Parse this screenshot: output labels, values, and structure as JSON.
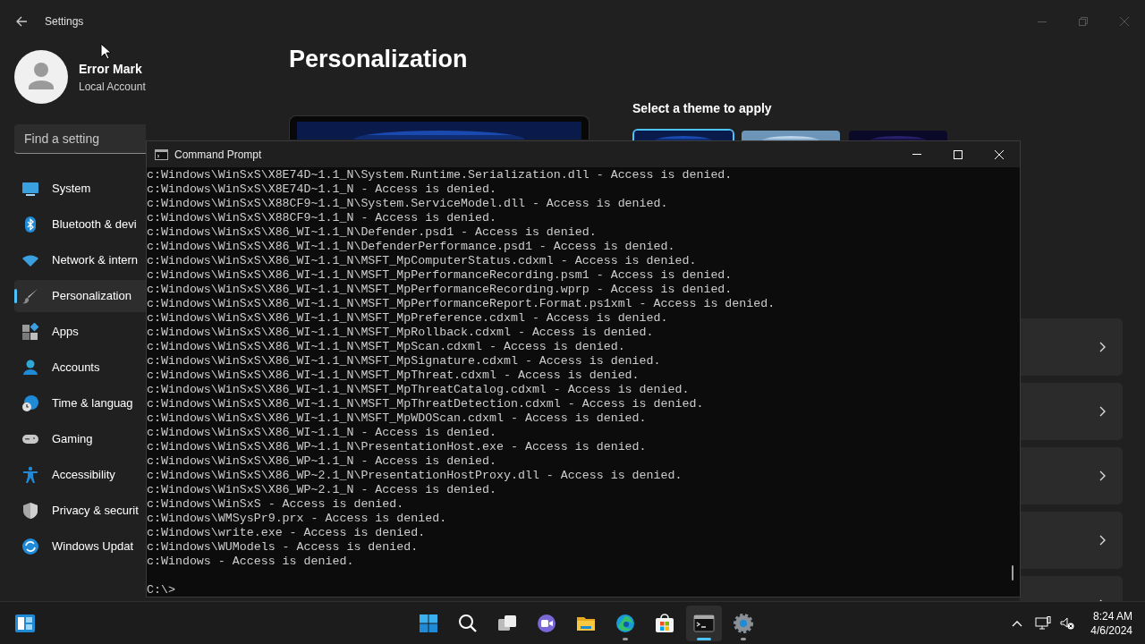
{
  "settings": {
    "title": "Settings",
    "user": {
      "name": "Error Mark",
      "account": "Local Account"
    },
    "search": {
      "placeholder": "Find a setting"
    },
    "nav": [
      {
        "kind": "system",
        "label": "System",
        "selected": false
      },
      {
        "kind": "bluetooth",
        "label": "Bluetooth & devi",
        "selected": false
      },
      {
        "kind": "network",
        "label": "Network & intern",
        "selected": false
      },
      {
        "kind": "personalization",
        "label": "Personalization",
        "selected": true
      },
      {
        "kind": "apps",
        "label": "Apps",
        "selected": false
      },
      {
        "kind": "accounts",
        "label": "Accounts",
        "selected": false
      },
      {
        "kind": "time",
        "label": "Time & languag",
        "selected": false
      },
      {
        "kind": "gaming",
        "label": "Gaming",
        "selected": false
      },
      {
        "kind": "accessibility",
        "label": "Accessibility",
        "selected": false
      },
      {
        "kind": "privacy",
        "label": "Privacy & securit",
        "selected": false
      },
      {
        "kind": "update",
        "label": "Windows Updat",
        "selected": false
      }
    ],
    "page_title": "Personalization",
    "theme_heading": "Select a theme to apply",
    "themes": [
      {
        "kind": "picture",
        "selected": true
      },
      {
        "kind": "picture",
        "selected": false
      },
      {
        "kind": "picture",
        "selected": false
      }
    ]
  },
  "cmd": {
    "title": "Command Prompt",
    "lines": [
      "c:Windows\\WinSxS\\X8E74D~1.1_N\\System.Runtime.Serialization.dll - Access is denied.",
      "c:Windows\\WinSxS\\X8E74D~1.1_N - Access is denied.",
      "c:Windows\\WinSxS\\X88CF9~1.1_N\\System.ServiceModel.dll - Access is denied.",
      "c:Windows\\WinSxS\\X88CF9~1.1_N - Access is denied.",
      "c:Windows\\WinSxS\\X86_WI~1.1_N\\Defender.psd1 - Access is denied.",
      "c:Windows\\WinSxS\\X86_WI~1.1_N\\DefenderPerformance.psd1 - Access is denied.",
      "c:Windows\\WinSxS\\X86_WI~1.1_N\\MSFT_MpComputerStatus.cdxml - Access is denied.",
      "c:Windows\\WinSxS\\X86_WI~1.1_N\\MSFT_MpPerformanceRecording.psm1 - Access is denied.",
      "c:Windows\\WinSxS\\X86_WI~1.1_N\\MSFT_MpPerformanceRecording.wprp - Access is denied.",
      "c:Windows\\WinSxS\\X86_WI~1.1_N\\MSFT_MpPerformanceReport.Format.ps1xml - Access is denied.",
      "c:Windows\\WinSxS\\X86_WI~1.1_N\\MSFT_MpPreference.cdxml - Access is denied.",
      "c:Windows\\WinSxS\\X86_WI~1.1_N\\MSFT_MpRollback.cdxml - Access is denied.",
      "c:Windows\\WinSxS\\X86_WI~1.1_N\\MSFT_MpScan.cdxml - Access is denied.",
      "c:Windows\\WinSxS\\X86_WI~1.1_N\\MSFT_MpSignature.cdxml - Access is denied.",
      "c:Windows\\WinSxS\\X86_WI~1.1_N\\MSFT_MpThreat.cdxml - Access is denied.",
      "c:Windows\\WinSxS\\X86_WI~1.1_N\\MSFT_MpThreatCatalog.cdxml - Access is denied.",
      "c:Windows\\WinSxS\\X86_WI~1.1_N\\MSFT_MpThreatDetection.cdxml - Access is denied.",
      "c:Windows\\WinSxS\\X86_WI~1.1_N\\MSFT_MpWDOScan.cdxml - Access is denied.",
      "c:Windows\\WinSxS\\X86_WI~1.1_N - Access is denied.",
      "c:Windows\\WinSxS\\X86_WP~1.1_N\\PresentationHost.exe - Access is denied.",
      "c:Windows\\WinSxS\\X86_WP~1.1_N - Access is denied.",
      "c:Windows\\WinSxS\\X86_WP~2.1_N\\PresentationHostProxy.dll - Access is denied.",
      "c:Windows\\WinSxS\\X86_WP~2.1_N - Access is denied.",
      "c:Windows\\WinSxS - Access is denied.",
      "c:Windows\\WMSysPr9.prx - Access is denied.",
      "c:Windows\\write.exe - Access is denied.",
      "c:Windows\\WUModels - Access is denied.",
      "c:Windows - Access is denied."
    ],
    "prompt": "C:\\>"
  },
  "taskbar": {
    "apps": [
      {
        "kind": "start",
        "running": false,
        "active": false
      },
      {
        "kind": "search",
        "running": false,
        "active": false
      },
      {
        "kind": "taskview",
        "running": false,
        "active": false
      },
      {
        "kind": "chat",
        "running": false,
        "active": false
      },
      {
        "kind": "explorer",
        "running": false,
        "active": false
      },
      {
        "kind": "edge",
        "running": true,
        "active": false
      },
      {
        "kind": "store",
        "running": false,
        "active": false
      },
      {
        "kind": "terminal",
        "running": true,
        "active": true
      },
      {
        "kind": "settings",
        "running": true,
        "active": false
      }
    ],
    "time": "8:24 AM",
    "date": "4/6/2024"
  }
}
